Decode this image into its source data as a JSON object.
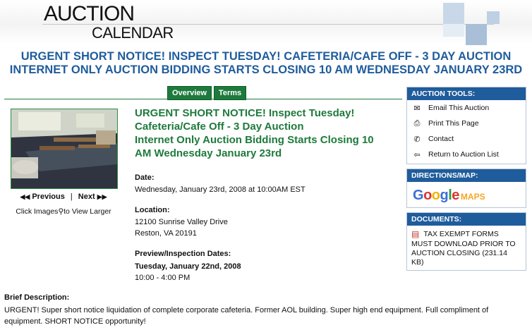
{
  "header": {
    "logo_line1": "AUCTION",
    "logo_line2": "CALENDAR"
  },
  "main_title": {
    "line1": "URGENT SHORT NOTICE! INSPECT TUESDAY! CAFETERIA/CAFE OFF - 3 DAY AUCTION",
    "line2": "INTERNET ONLY AUCTION BIDDING STARTS CLOSING 10 AM WEDNESDAY JANUARY 23RD"
  },
  "tabs": [
    {
      "label": "Overview"
    },
    {
      "label": "Terms"
    }
  ],
  "photo_nav": {
    "previous": "Previous",
    "next": "Next",
    "click_prefix": "Click Images",
    "click_suffix": "to View Larger"
  },
  "auction": {
    "heading_lines": [
      "URGENT SHORT NOTICE! Inspect Tuesday!",
      "Cafeteria/Cafe Off - 3 Day Auction",
      "Internet Only Auction Bidding Starts Closing 10",
      "AM Wednesday January 23rd"
    ],
    "date_label": "Date:",
    "date_value": "Wednesday, January 23rd, 2008  at 10:00AM EST",
    "location_label": "Location:",
    "location_line1": "12100 Sunrise Valley Drive",
    "location_line2": "Reston, VA 20191",
    "preview_label": "Preview/Inspection Dates:",
    "preview_date": "Tuesday, January 22nd, 2008",
    "preview_time": "10:00 - 4:00 PM"
  },
  "brief": {
    "label": "Brief Description:",
    "text": "URGENT! Super short notice liquidation of complete corporate cafeteria. Former AOL building. Super high end equipment. Full compliment of equipment. SHORT NOTICE opportunity!"
  },
  "tools": {
    "heading": "AUCTION TOOLS:",
    "items": [
      {
        "label": "Email This Auction",
        "icon": "envelope-icon"
      },
      {
        "label": "Print This Page",
        "icon": "printer-icon"
      },
      {
        "label": "Contact",
        "icon": "phone-icon"
      },
      {
        "label": "Return to Auction List",
        "icon": "back-arrow-icon"
      }
    ]
  },
  "directions": {
    "heading": "DIRECTIONS/MAP:",
    "maps_word": "MAPS"
  },
  "documents": {
    "heading": "DOCUMENTS:",
    "doc_label": "TAX EXEMPT FORMS",
    "doc_note": "MUST DOWNLOAD PRIOR TO AUCTION CLOSING",
    "doc_size": "(231.14 KB)"
  },
  "colors": {
    "brand_blue": "#1f5c9c",
    "brand_green": "#1e7a3c"
  }
}
